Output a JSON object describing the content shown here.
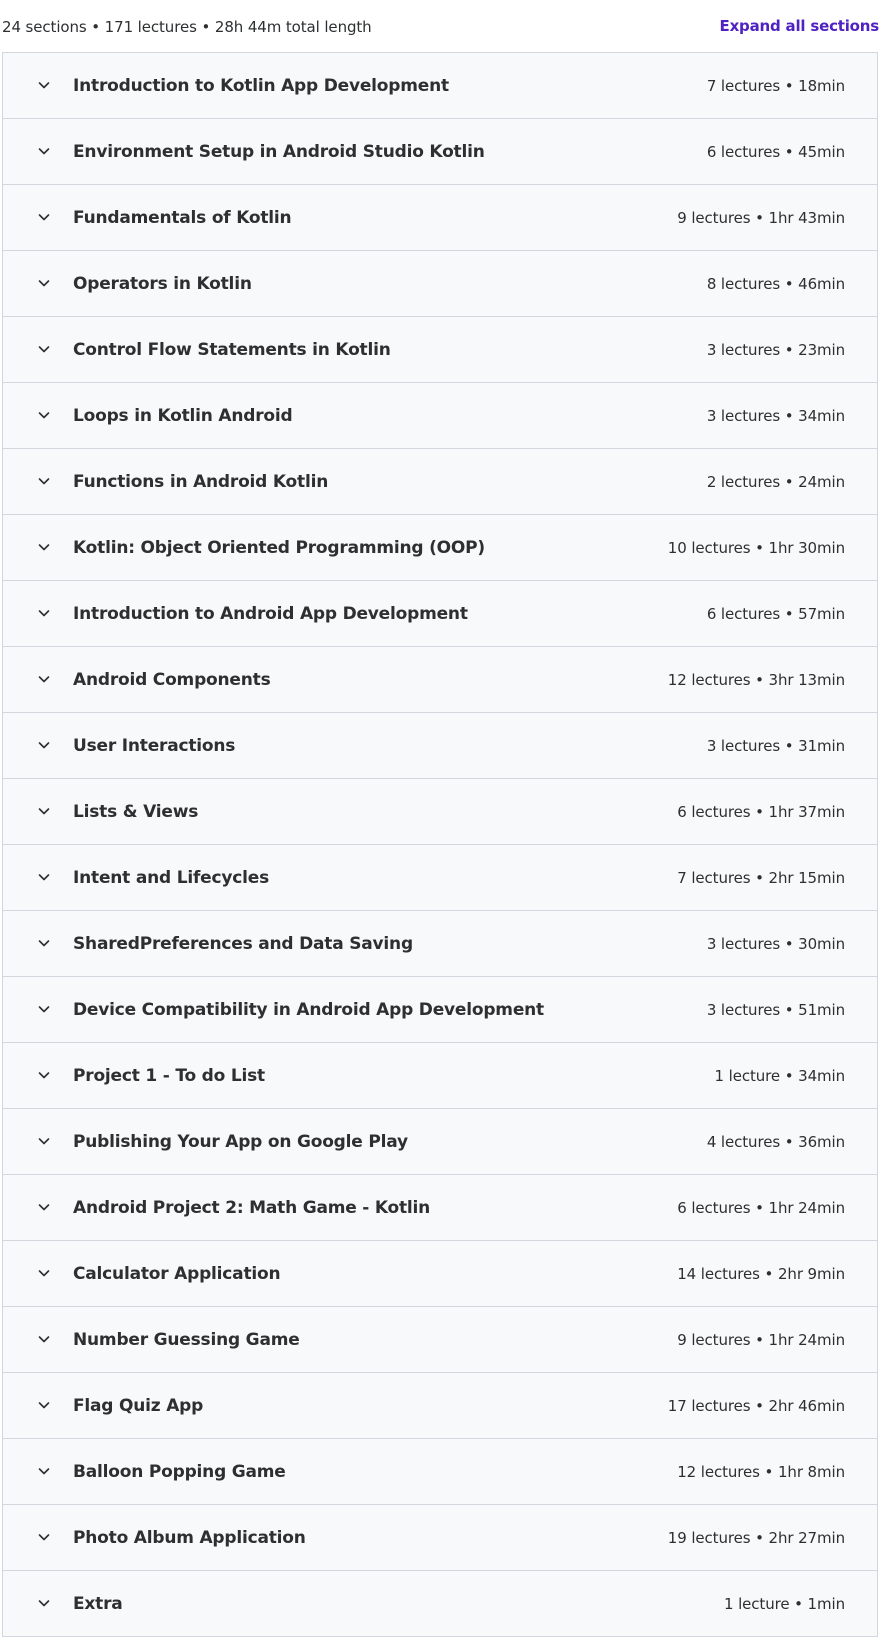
{
  "header": {
    "summary": "24 sections • 171 lectures • 28h 44m total length",
    "expand_all_label": "Expand all sections"
  },
  "icons": {
    "section_toggle": "chevron-down-icon"
  },
  "colors": {
    "link": "#5022c3",
    "row_background": "#f7f9fa",
    "border": "#d1d7dc",
    "text": "#2d2f31"
  },
  "sections": [
    {
      "title": "Introduction to Kotlin App Development",
      "meta": "7 lectures • 18min"
    },
    {
      "title": "Environment Setup in Android Studio Kotlin",
      "meta": "6 lectures • 45min"
    },
    {
      "title": "Fundamentals of Kotlin",
      "meta": "9 lectures • 1hr 43min"
    },
    {
      "title": "Operators in Kotlin",
      "meta": "8 lectures • 46min"
    },
    {
      "title": "Control Flow Statements in Kotlin",
      "meta": "3 lectures • 23min"
    },
    {
      "title": "Loops in Kotlin Android",
      "meta": "3 lectures • 34min"
    },
    {
      "title": "Functions in Android Kotlin",
      "meta": "2 lectures • 24min"
    },
    {
      "title": "Kotlin: Object Oriented Programming (OOP)",
      "meta": "10 lectures • 1hr 30min"
    },
    {
      "title": "Introduction to Android App Development",
      "meta": "6 lectures • 57min"
    },
    {
      "title": "Android Components",
      "meta": "12 lectures • 3hr 13min"
    },
    {
      "title": "User Interactions",
      "meta": "3 lectures • 31min"
    },
    {
      "title": "Lists & Views",
      "meta": "6 lectures • 1hr 37min"
    },
    {
      "title": "Intent and Lifecycles",
      "meta": "7 lectures • 2hr 15min"
    },
    {
      "title": "SharedPreferences and Data Saving",
      "meta": "3 lectures • 30min"
    },
    {
      "title": "Device Compatibility in Android App Development",
      "meta": "3 lectures • 51min"
    },
    {
      "title": "Project 1 - To do List",
      "meta": "1 lecture • 34min"
    },
    {
      "title": "Publishing Your App on Google Play",
      "meta": "4 lectures • 36min"
    },
    {
      "title": "Android Project 2: Math Game - Kotlin",
      "meta": "6 lectures • 1hr 24min"
    },
    {
      "title": "Calculator Application",
      "meta": "14 lectures • 2hr 9min"
    },
    {
      "title": "Number Guessing Game",
      "meta": "9 lectures • 1hr 24min"
    },
    {
      "title": "Flag Quiz App",
      "meta": "17 lectures • 2hr 46min"
    },
    {
      "title": "Balloon Popping Game",
      "meta": "12 lectures • 1hr 8min"
    },
    {
      "title": "Photo Album Application",
      "meta": "19 lectures • 2hr 27min"
    },
    {
      "title": "Extra",
      "meta": "1 lecture • 1min"
    }
  ]
}
